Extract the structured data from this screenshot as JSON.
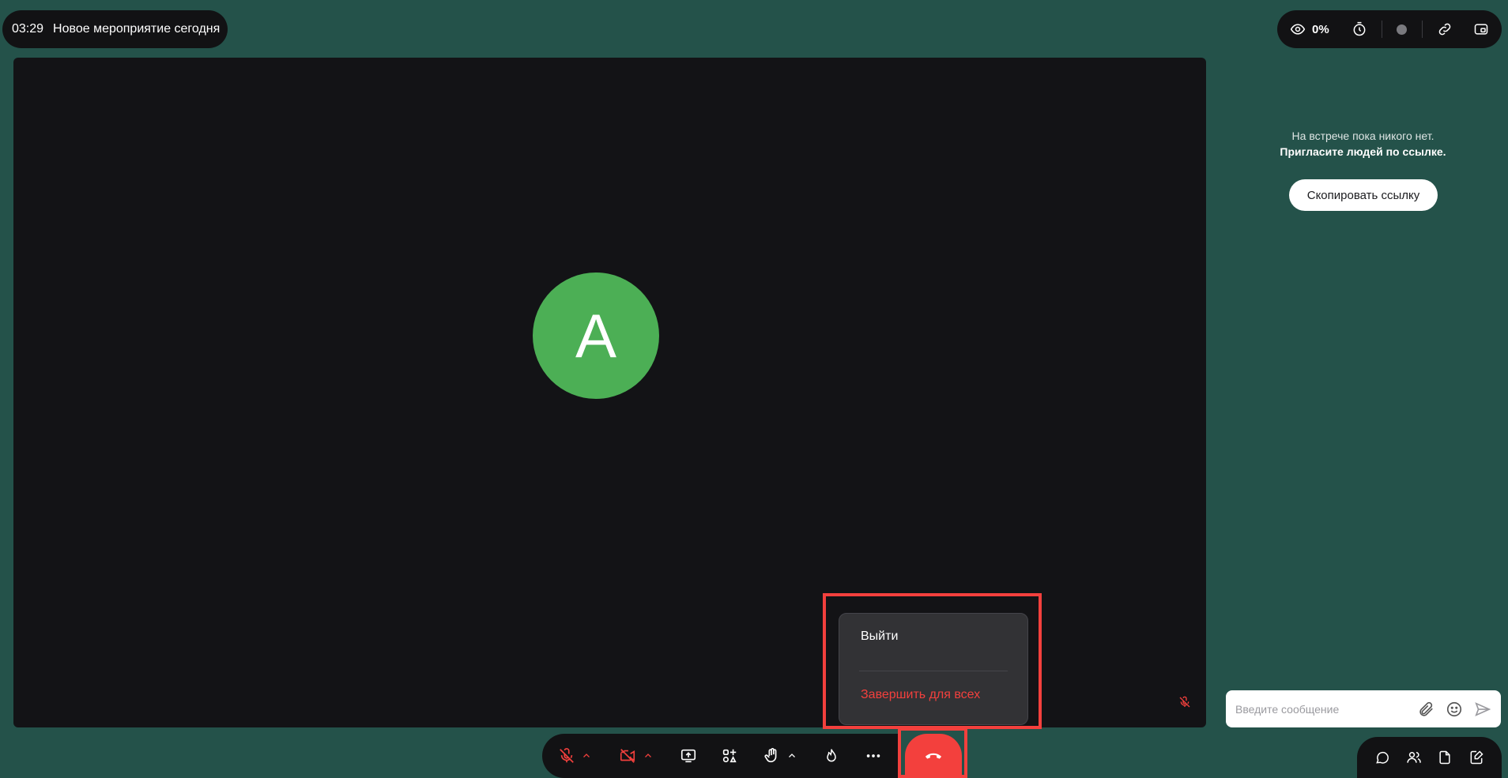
{
  "header": {
    "elapsed_time": "03:29",
    "meeting_title": "Новое мероприятие сегодня",
    "viewers_percent": "0%"
  },
  "participant": {
    "avatar_letter": "A",
    "avatar_color": "#4caf55"
  },
  "side_panel": {
    "empty_line1": "На встрече пока никого нет.",
    "empty_line2": "Пригласите людей по ссылке.",
    "copy_link_label": "Скопировать ссылку"
  },
  "chat": {
    "placeholder": "Введите сообщение"
  },
  "leave_menu": {
    "exit_label": "Выйти",
    "end_for_all_label": "Завершить для всех"
  },
  "colors": {
    "background": "#24524a",
    "panel": "#121214",
    "danger": "#f3403d"
  },
  "icons": {
    "top_right": [
      "eye-icon",
      "timer-icon",
      "record-icon",
      "link-icon",
      "picture-in-picture-icon"
    ],
    "controls": [
      "mic-off-icon",
      "camera-off-icon",
      "screen-share-icon",
      "apps-icon",
      "raise-hand-icon",
      "reactions-icon",
      "more-icon",
      "hangup-icon"
    ],
    "bottom_right": [
      "chat-icon",
      "participants-icon",
      "files-icon",
      "notes-icon"
    ]
  }
}
